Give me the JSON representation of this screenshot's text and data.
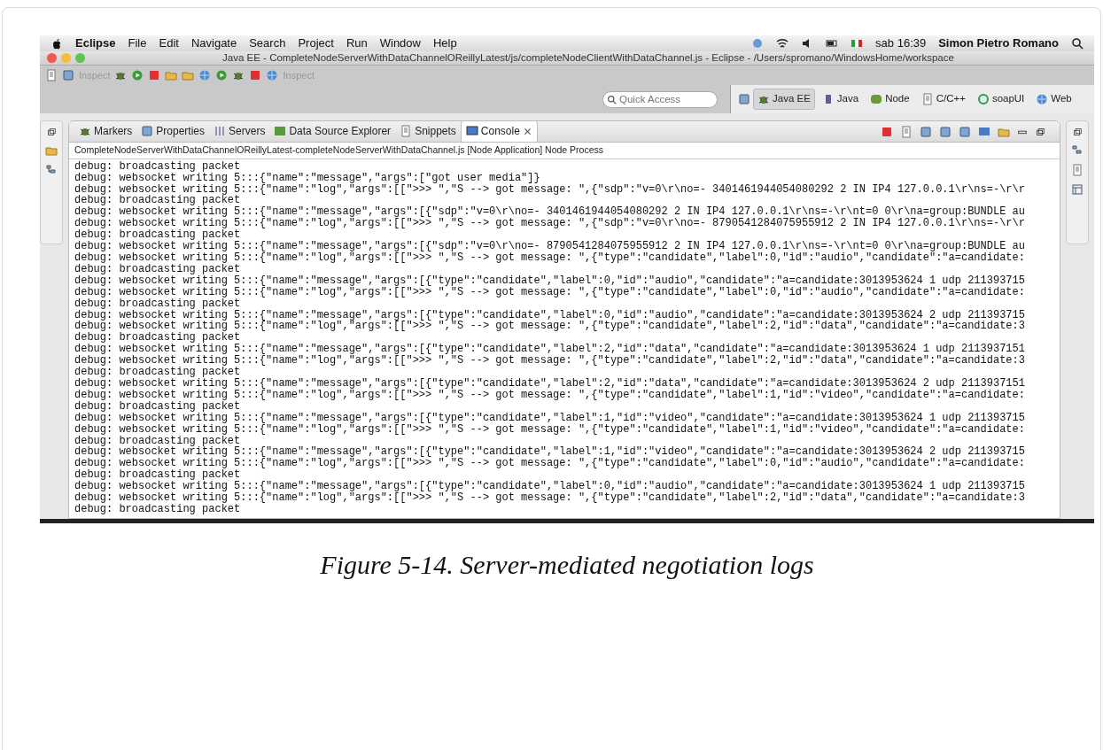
{
  "menubar": {
    "app_name": "Eclipse",
    "items": [
      "File",
      "Edit",
      "Navigate",
      "Search",
      "Project",
      "Run",
      "Window",
      "Help"
    ],
    "clock": "sab 16:39",
    "user": "Simon Pietro Romano"
  },
  "window": {
    "title": "Java EE - CompleteNodeServerWithDataChannelOReillyLatest/js/completeNodeClientWithDataChannel.js - Eclipse - /Users/spromano/WindowsHome/workspace"
  },
  "toolbar": {
    "inspect_labels": [
      "Inspect",
      "Inspect"
    ],
    "quick_access": {
      "placeholder": "Quick Access"
    },
    "perspectives": [
      {
        "label": "Java EE",
        "selected": true
      },
      {
        "label": "Java",
        "selected": false
      },
      {
        "label": "Node",
        "selected": false
      },
      {
        "label": "C/C++",
        "selected": false
      },
      {
        "label": "soapUI",
        "selected": false
      },
      {
        "label": "Web",
        "selected": false
      }
    ]
  },
  "view_tabs": [
    {
      "label": "Markers",
      "selected": false
    },
    {
      "label": "Properties",
      "selected": false
    },
    {
      "label": "Servers",
      "selected": false
    },
    {
      "label": "Data Source Explorer",
      "selected": false
    },
    {
      "label": "Snippets",
      "selected": false
    },
    {
      "label": "Console",
      "selected": true
    }
  ],
  "console": {
    "process": "CompleteNodeServerWithDataChannelOReillyLatest-completeNodeServerWithDataChannel.js [Node Application] Node Process",
    "lines": [
      "debug: broadcasting packet",
      "debug: websocket writing 5:::{\"name\":\"message\",\"args\":[\"got user media\"]}",
      "debug: websocket writing 5:::{\"name\":\"log\",\"args\":[[\">>> \",\"S --> got message: \",{\"sdp\":\"v=0\\r\\no=- 3401461944054080292 2 IN IP4 127.0.0.1\\r\\ns=-\\r\\r",
      "debug: broadcasting packet",
      "debug: websocket writing 5:::{\"name\":\"message\",\"args\":[{\"sdp\":\"v=0\\r\\no=- 3401461944054080292 2 IN IP4 127.0.0.1\\r\\ns=-\\r\\nt=0 0\\r\\na=group:BUNDLE au",
      "debug: websocket writing 5:::{\"name\":\"log\",\"args\":[[\">>> \",\"S --> got message: \",{\"sdp\":\"v=0\\r\\no=- 8790541284075955912 2 IN IP4 127.0.0.1\\r\\ns=-\\r\\r",
      "debug: broadcasting packet",
      "debug: websocket writing 5:::{\"name\":\"message\",\"args\":[{\"sdp\":\"v=0\\r\\no=- 8790541284075955912 2 IN IP4 127.0.0.1\\r\\ns=-\\r\\nt=0 0\\r\\na=group:BUNDLE au",
      "debug: websocket writing 5:::{\"name\":\"log\",\"args\":[[\">>> \",\"S --> got message: \",{\"type\":\"candidate\",\"label\":0,\"id\":\"audio\",\"candidate\":\"a=candidate:",
      "debug: broadcasting packet",
      "debug: websocket writing 5:::{\"name\":\"message\",\"args\":[{\"type\":\"candidate\",\"label\":0,\"id\":\"audio\",\"candidate\":\"a=candidate:3013953624 1 udp 211393715",
      "debug: websocket writing 5:::{\"name\":\"log\",\"args\":[[\">>> \",\"S --> got message: \",{\"type\":\"candidate\",\"label\":0,\"id\":\"audio\",\"candidate\":\"a=candidate:",
      "debug: broadcasting packet",
      "debug: websocket writing 5:::{\"name\":\"message\",\"args\":[{\"type\":\"candidate\",\"label\":0,\"id\":\"audio\",\"candidate\":\"a=candidate:3013953624 2 udp 211393715",
      "debug: websocket writing 5:::{\"name\":\"log\",\"args\":[[\">>> \",\"S --> got message: \",{\"type\":\"candidate\",\"label\":2,\"id\":\"data\",\"candidate\":\"a=candidate:3",
      "debug: broadcasting packet",
      "debug: websocket writing 5:::{\"name\":\"message\",\"args\":[{\"type\":\"candidate\",\"label\":2,\"id\":\"data\",\"candidate\":\"a=candidate:3013953624 1 udp 2113937151",
      "debug: websocket writing 5:::{\"name\":\"log\",\"args\":[[\">>> \",\"S --> got message: \",{\"type\":\"candidate\",\"label\":2,\"id\":\"data\",\"candidate\":\"a=candidate:3",
      "debug: broadcasting packet",
      "debug: websocket writing 5:::{\"name\":\"message\",\"args\":[{\"type\":\"candidate\",\"label\":2,\"id\":\"data\",\"candidate\":\"a=candidate:3013953624 2 udp 2113937151",
      "debug: websocket writing 5:::{\"name\":\"log\",\"args\":[[\">>> \",\"S --> got message: \",{\"type\":\"candidate\",\"label\":1,\"id\":\"video\",\"candidate\":\"a=candidate:",
      "debug: broadcasting packet",
      "debug: websocket writing 5:::{\"name\":\"message\",\"args\":[{\"type\":\"candidate\",\"label\":1,\"id\":\"video\",\"candidate\":\"a=candidate:3013953624 1 udp 211393715",
      "debug: websocket writing 5:::{\"name\":\"log\",\"args\":[[\">>> \",\"S --> got message: \",{\"type\":\"candidate\",\"label\":1,\"id\":\"video\",\"candidate\":\"a=candidate:",
      "debug: broadcasting packet",
      "debug: websocket writing 5:::{\"name\":\"message\",\"args\":[{\"type\":\"candidate\",\"label\":1,\"id\":\"video\",\"candidate\":\"a=candidate:3013953624 2 udp 211393715",
      "debug: websocket writing 5:::{\"name\":\"log\",\"args\":[[\">>> \",\"S --> got message: \",{\"type\":\"candidate\",\"label\":0,\"id\":\"audio\",\"candidate\":\"a=candidate:",
      "debug: broadcasting packet",
      "debug: websocket writing 5:::{\"name\":\"message\",\"args\":[{\"type\":\"candidate\",\"label\":0,\"id\":\"audio\",\"candidate\":\"a=candidate:3013953624 1 udp 211393715",
      "debug: websocket writing 5:::{\"name\":\"log\",\"args\":[[\">>> \",\"S --> got message: \",{\"type\":\"candidate\",\"label\":2,\"id\":\"data\",\"candidate\":\"a=candidate:3",
      "debug: broadcasting packet"
    ]
  },
  "caption": "Figure 5-14. Server-mediated negotiation logs"
}
